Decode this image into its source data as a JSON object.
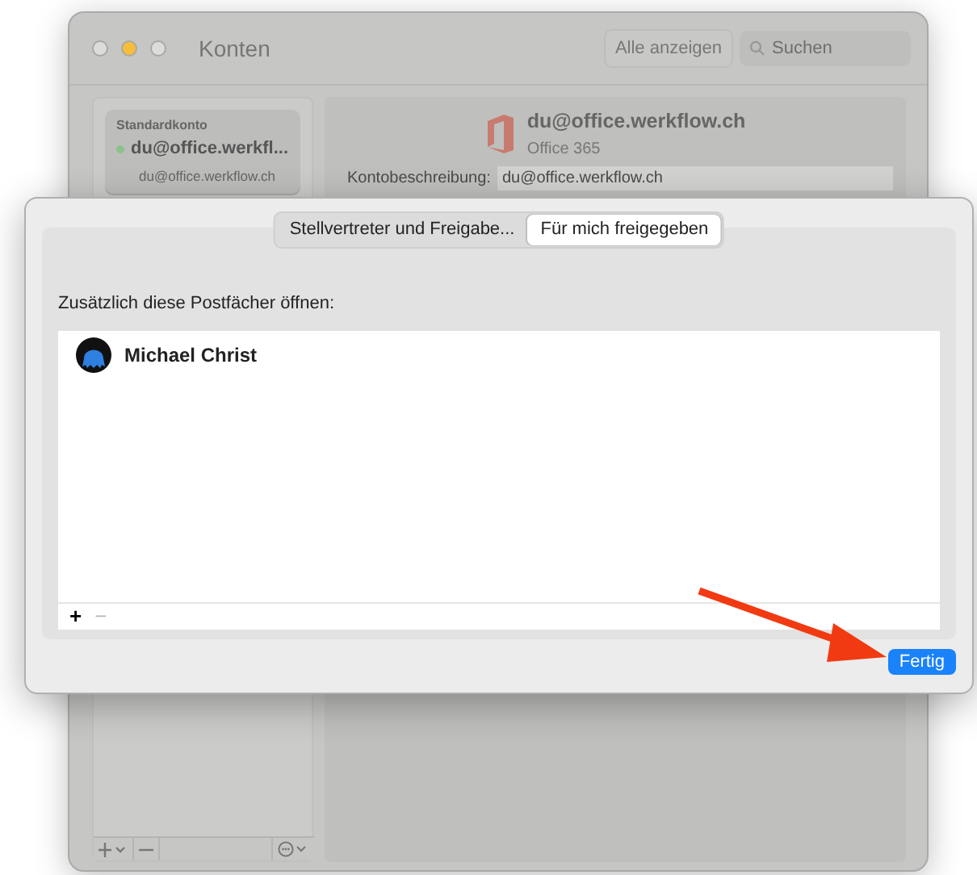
{
  "window": {
    "title": "Konten",
    "toolbar_button": "Alle anzeigen",
    "search": {
      "placeholder": "Suchen"
    }
  },
  "sidebar": {
    "accounts": [
      {
        "section": "Standardkonto",
        "name": "du@office.werkfl...",
        "email": "du@office.werkflow.ch",
        "online": true,
        "selected": true
      }
    ]
  },
  "account_detail": {
    "title": "du@office.werkflow.ch",
    "type": "Office 365",
    "fields": [
      {
        "label": "Kontobeschreibung:",
        "value": "du@office.werkflow.ch"
      }
    ]
  },
  "sheet": {
    "tabs": [
      {
        "label": "Stellvertreter und Freigabe...",
        "selected": false
      },
      {
        "label": "Für mich freigegeben",
        "selected": true
      }
    ],
    "heading": "Zusätzlich diese Postfächer öffnen:",
    "mailboxes": [
      {
        "name": "Michael Christ"
      }
    ],
    "list_buttons": [
      {
        "label": "+",
        "disabled": false
      },
      {
        "label": "−",
        "disabled": true
      }
    ],
    "done_button": "Fertig"
  }
}
